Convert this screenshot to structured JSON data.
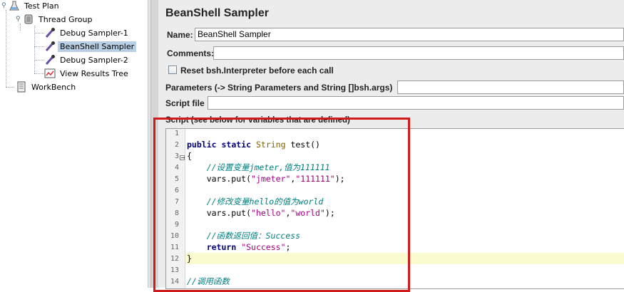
{
  "tree": {
    "items": [
      {
        "label": "Test Plan",
        "icon": "test-plan-icon"
      },
      {
        "label": "Thread Group",
        "icon": "thread-group-icon"
      },
      {
        "label": "Debug Sampler-1",
        "icon": "dropper-icon"
      },
      {
        "label": "BeanShell Sampler",
        "icon": "dropper-icon",
        "selected": true
      },
      {
        "label": "Debug Sampler-2",
        "icon": "dropper-icon"
      },
      {
        "label": "View Results Tree",
        "icon": "results-tree-icon"
      },
      {
        "label": "WorkBench",
        "icon": "workbench-icon"
      }
    ]
  },
  "panel": {
    "title": "BeanShell Sampler",
    "name_label": "Name:",
    "name_value": "BeanShell Sampler",
    "comments_label": "Comments:",
    "comments_value": "",
    "reset_label": "Reset bsh.Interpreter before each call",
    "reset_checked": false,
    "params_label": "Parameters (-> String Parameters and String []bsh.args)",
    "params_value": "",
    "script_file_label": "Script file",
    "script_file_value": "",
    "script_label": "Script (see below for variables that are defined)"
  },
  "script": {
    "line_numbers": [
      "1",
      "2",
      "3",
      "4",
      "5",
      "6",
      "7",
      "8",
      "9",
      "10",
      "11",
      "12",
      "13",
      "14"
    ],
    "lines": [
      "",
      "public static String test()",
      "{",
      "    //设置变量jmeter,值为111111",
      "    vars.put(\"jmeter\",\"111111\");",
      "",
      "    //修改变量hello的值为world",
      "    vars.put(\"hello\",\"world\");",
      "",
      "    //函数返回值：Success",
      "    return \"Success\";",
      "}",
      "",
      "//调用函数"
    ]
  },
  "colors": {
    "keyword": "#00007f",
    "type": "#7f5f00",
    "string": "#a0007f",
    "comment": "#007f7f",
    "annotation_box": "#d21a1a",
    "selected_row": "#b8cfe5",
    "current_line": "#fbfbd0"
  }
}
